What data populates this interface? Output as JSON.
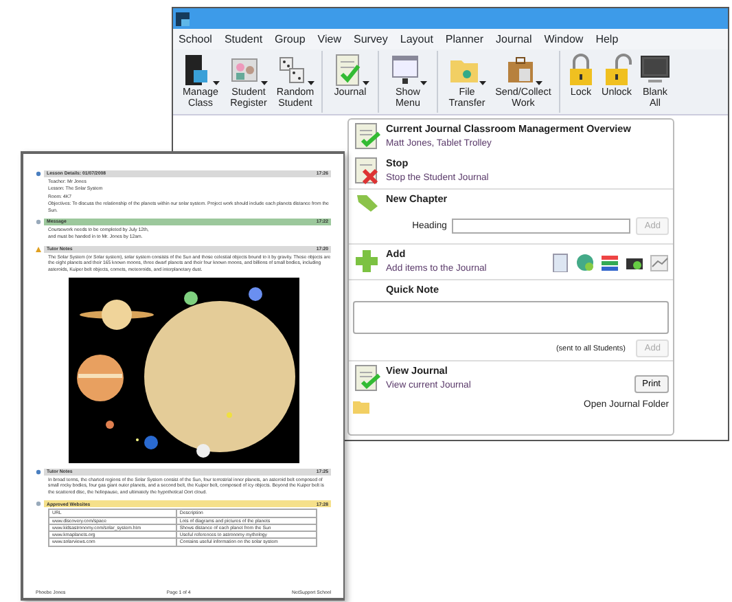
{
  "window": {
    "menu": [
      "School",
      "Student",
      "Group",
      "View",
      "Survey",
      "Layout",
      "Planner",
      "Journal",
      "Window",
      "Help"
    ],
    "toolbar": [
      [
        {
          "label": "Manage Class",
          "dropdown": true
        },
        {
          "label": "Student Register",
          "dropdown": true
        },
        {
          "label": "Random Student",
          "dropdown": true
        }
      ],
      [
        {
          "label": "Journal",
          "dropdown": true
        }
      ],
      [
        {
          "label": "Show Menu",
          "dropdown": true
        }
      ],
      [
        {
          "label": "File Transfer",
          "dropdown": true
        },
        {
          "label": "Send/Collect Work",
          "dropdown": true
        }
      ],
      [
        {
          "label": "Lock",
          "dropdown": false
        },
        {
          "label": "Unlock",
          "dropdown": false
        },
        {
          "label": "Blank All",
          "dropdown": false
        }
      ]
    ]
  },
  "journal_panel": [
    {
      "kind": "action",
      "title": "Current Journal Classroom Managerment Overview",
      "subtitle": "Matt Jones, Tablet Trolley"
    },
    {
      "kind": "action",
      "title": "Stop",
      "subtitle": "Stop the Student Journal"
    },
    {
      "kind": "chapter",
      "title": "New Chapter",
      "field_label": "Heading",
      "button": "Add",
      "disabled": true
    },
    {
      "kind": "add",
      "title": "Add",
      "subtitle": "Add items to the Journal"
    },
    {
      "kind": "note",
      "title": "Quick Note",
      "hint": "(sent to all Students)",
      "button": "Add",
      "disabled": true
    },
    {
      "kind": "view",
      "title": "View Journal",
      "subtitle": "View current Journal",
      "button": "Print",
      "link": "Open Journal Folder"
    }
  ],
  "document": {
    "sections": [
      {
        "title": "Lesson Details: 01/07/2008",
        "time": "17:26",
        "color": "#d9d9d9",
        "blocks": [
          {
            "kind": "text",
            "text": "Teacher: Mr Jones"
          },
          {
            "kind": "text",
            "text": "Lesson: The Solar System"
          },
          {
            "kind": "text",
            "text": "Room: 4K7"
          },
          {
            "kind": "text",
            "text": "Objectives: To discuss the relationship of the planets within our solar system. Project work should include each planets distance from the Sun."
          }
        ]
      },
      {
        "title": "Message",
        "time": "17:22",
        "color": "#9cc89c",
        "blocks": [
          {
            "kind": "text",
            "text": "Coursework needs to be completed by July 12th,"
          },
          {
            "kind": "text",
            "text": "and must be handed in to Mr. Jones by 12am."
          }
        ]
      },
      {
        "title": "Tutor Notes",
        "time": "17:20",
        "color": "#d9d9d9",
        "blocks": [
          {
            "kind": "text",
            "text": "The Solar System (or Solar system), solar system consists of the Sun and those celestial objects bound to it by gravity. These objects are the eight planets and their 165 known moons, three dwarf planets and their four known moons, and billions of small bodies, including asteroids, Kuiper belt objects, comets, meteoroids, and interplanetary dust."
          },
          {
            "kind": "picture"
          }
        ]
      },
      {
        "title": "Tutor Notes",
        "time": "17:25",
        "color": "#d9d9d9",
        "blocks": [
          {
            "kind": "text",
            "text": "In broad terms, the charted regions of the Solar System consist of the Sun, four terrestrial inner planets, an asteroid belt composed of small rocky bodies, four gas giant outer planets, and a second belt, the Kuiper belt, composed of icy objects. Beyond the Kuiper belt is the scattered disc, the heliopause, and ultimately the hypothetical Oort cloud."
          }
        ]
      },
      {
        "title": "Approved Websites",
        "time": "17:28",
        "color": "#f5e08a",
        "blocks": [
          {
            "kind": "table",
            "columns": [
              "URL",
              "Description"
            ],
            "rows": [
              [
                "www.discovery.com/space",
                "Lots of diagrams and pictures of the planets"
              ],
              [
                "www.kidsastronomy.com/solar_system.htm",
                "Shows distance of each planet from the Sun"
              ],
              [
                "www.kmaplanets.org",
                "Useful references to astronomy mythology"
              ],
              [
                "www.solarviews.com",
                "Contains useful information on the solar system"
              ]
            ]
          }
        ]
      }
    ],
    "footer": [
      "Phoebe Jones",
      "Page 1 of 4",
      "NetSupport School"
    ]
  }
}
